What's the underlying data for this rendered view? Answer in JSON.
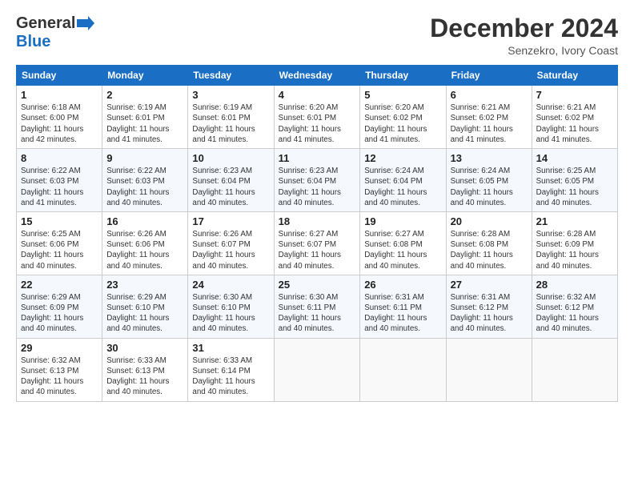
{
  "header": {
    "logo_general": "General",
    "logo_blue": "Blue",
    "month_title": "December 2024",
    "location": "Senzekro, Ivory Coast"
  },
  "days_of_week": [
    "Sunday",
    "Monday",
    "Tuesday",
    "Wednesday",
    "Thursday",
    "Friday",
    "Saturday"
  ],
  "weeks": [
    [
      {
        "day": "1",
        "info": "Sunrise: 6:18 AM\nSunset: 6:00 PM\nDaylight: 11 hours\nand 42 minutes."
      },
      {
        "day": "2",
        "info": "Sunrise: 6:19 AM\nSunset: 6:01 PM\nDaylight: 11 hours\nand 41 minutes."
      },
      {
        "day": "3",
        "info": "Sunrise: 6:19 AM\nSunset: 6:01 PM\nDaylight: 11 hours\nand 41 minutes."
      },
      {
        "day": "4",
        "info": "Sunrise: 6:20 AM\nSunset: 6:01 PM\nDaylight: 11 hours\nand 41 minutes."
      },
      {
        "day": "5",
        "info": "Sunrise: 6:20 AM\nSunset: 6:02 PM\nDaylight: 11 hours\nand 41 minutes."
      },
      {
        "day": "6",
        "info": "Sunrise: 6:21 AM\nSunset: 6:02 PM\nDaylight: 11 hours\nand 41 minutes."
      },
      {
        "day": "7",
        "info": "Sunrise: 6:21 AM\nSunset: 6:02 PM\nDaylight: 11 hours\nand 41 minutes."
      }
    ],
    [
      {
        "day": "8",
        "info": "Sunrise: 6:22 AM\nSunset: 6:03 PM\nDaylight: 11 hours\nand 41 minutes."
      },
      {
        "day": "9",
        "info": "Sunrise: 6:22 AM\nSunset: 6:03 PM\nDaylight: 11 hours\nand 40 minutes."
      },
      {
        "day": "10",
        "info": "Sunrise: 6:23 AM\nSunset: 6:04 PM\nDaylight: 11 hours\nand 40 minutes."
      },
      {
        "day": "11",
        "info": "Sunrise: 6:23 AM\nSunset: 6:04 PM\nDaylight: 11 hours\nand 40 minutes."
      },
      {
        "day": "12",
        "info": "Sunrise: 6:24 AM\nSunset: 6:04 PM\nDaylight: 11 hours\nand 40 minutes."
      },
      {
        "day": "13",
        "info": "Sunrise: 6:24 AM\nSunset: 6:05 PM\nDaylight: 11 hours\nand 40 minutes."
      },
      {
        "day": "14",
        "info": "Sunrise: 6:25 AM\nSunset: 6:05 PM\nDaylight: 11 hours\nand 40 minutes."
      }
    ],
    [
      {
        "day": "15",
        "info": "Sunrise: 6:25 AM\nSunset: 6:06 PM\nDaylight: 11 hours\nand 40 minutes."
      },
      {
        "day": "16",
        "info": "Sunrise: 6:26 AM\nSunset: 6:06 PM\nDaylight: 11 hours\nand 40 minutes."
      },
      {
        "day": "17",
        "info": "Sunrise: 6:26 AM\nSunset: 6:07 PM\nDaylight: 11 hours\nand 40 minutes."
      },
      {
        "day": "18",
        "info": "Sunrise: 6:27 AM\nSunset: 6:07 PM\nDaylight: 11 hours\nand 40 minutes."
      },
      {
        "day": "19",
        "info": "Sunrise: 6:27 AM\nSunset: 6:08 PM\nDaylight: 11 hours\nand 40 minutes."
      },
      {
        "day": "20",
        "info": "Sunrise: 6:28 AM\nSunset: 6:08 PM\nDaylight: 11 hours\nand 40 minutes."
      },
      {
        "day": "21",
        "info": "Sunrise: 6:28 AM\nSunset: 6:09 PM\nDaylight: 11 hours\nand 40 minutes."
      }
    ],
    [
      {
        "day": "22",
        "info": "Sunrise: 6:29 AM\nSunset: 6:09 PM\nDaylight: 11 hours\nand 40 minutes."
      },
      {
        "day": "23",
        "info": "Sunrise: 6:29 AM\nSunset: 6:10 PM\nDaylight: 11 hours\nand 40 minutes."
      },
      {
        "day": "24",
        "info": "Sunrise: 6:30 AM\nSunset: 6:10 PM\nDaylight: 11 hours\nand 40 minutes."
      },
      {
        "day": "25",
        "info": "Sunrise: 6:30 AM\nSunset: 6:11 PM\nDaylight: 11 hours\nand 40 minutes."
      },
      {
        "day": "26",
        "info": "Sunrise: 6:31 AM\nSunset: 6:11 PM\nDaylight: 11 hours\nand 40 minutes."
      },
      {
        "day": "27",
        "info": "Sunrise: 6:31 AM\nSunset: 6:12 PM\nDaylight: 11 hours\nand 40 minutes."
      },
      {
        "day": "28",
        "info": "Sunrise: 6:32 AM\nSunset: 6:12 PM\nDaylight: 11 hours\nand 40 minutes."
      }
    ],
    [
      {
        "day": "29",
        "info": "Sunrise: 6:32 AM\nSunset: 6:13 PM\nDaylight: 11 hours\nand 40 minutes."
      },
      {
        "day": "30",
        "info": "Sunrise: 6:33 AM\nSunset: 6:13 PM\nDaylight: 11 hours\nand 40 minutes."
      },
      {
        "day": "31",
        "info": "Sunrise: 6:33 AM\nSunset: 6:14 PM\nDaylight: 11 hours\nand 40 minutes."
      },
      null,
      null,
      null,
      null
    ]
  ]
}
